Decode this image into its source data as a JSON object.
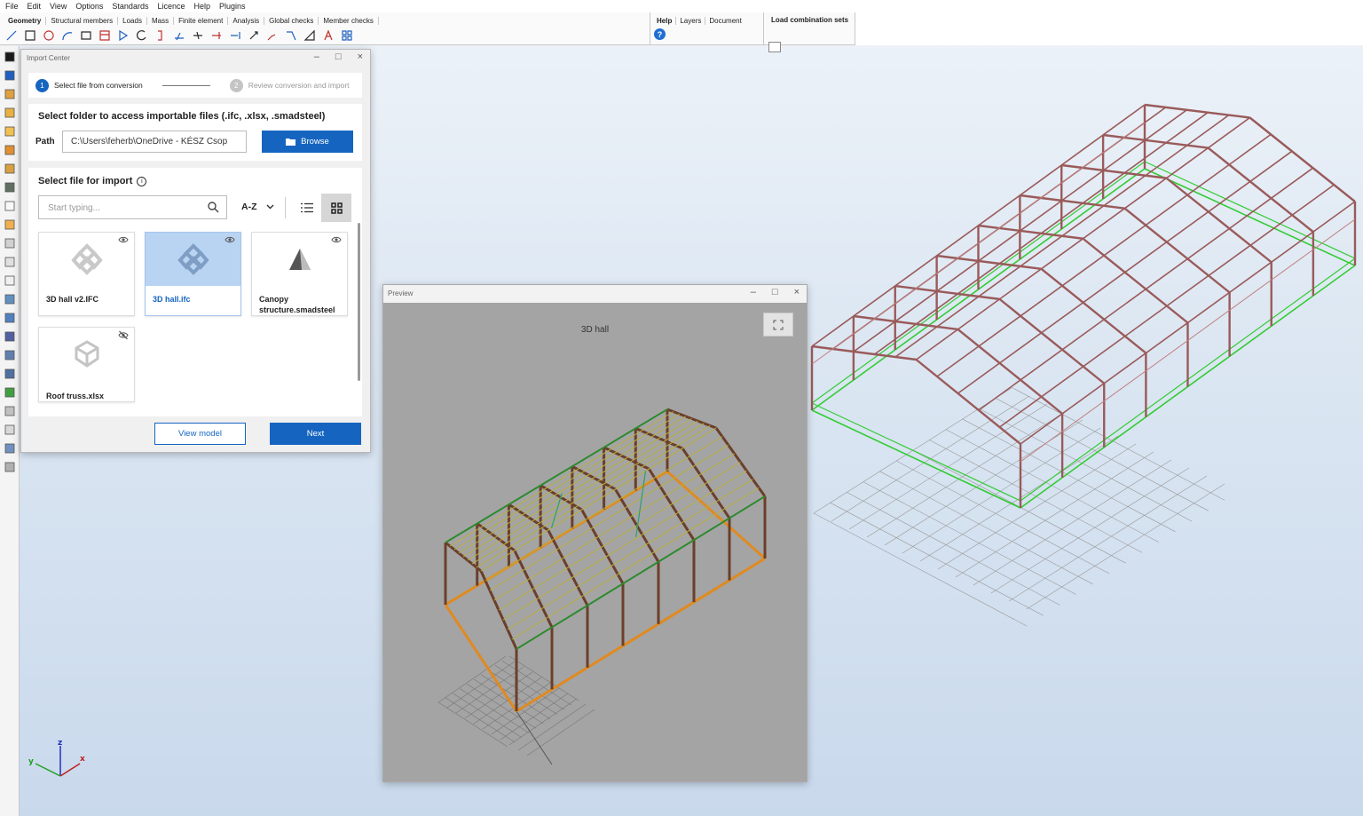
{
  "menu": [
    "File",
    "Edit",
    "View",
    "Options",
    "Standards",
    "Licence",
    "Help",
    "Plugins"
  ],
  "ribbon": {
    "tabs": [
      "Geometry",
      "Structural members",
      "Loads",
      "Mass",
      "Finite element",
      "Analysis",
      "Global checks",
      "Member checks"
    ],
    "help_tabs": [
      "Help",
      "Layers",
      "Document"
    ],
    "load_group_title": "Load combination sets",
    "help_icon_text": "?"
  },
  "import_center": {
    "title": "Import Center",
    "steps": [
      {
        "number": "1",
        "label": "Select file from conversion",
        "active": true
      },
      {
        "number": "2",
        "label": "Review conversion and import",
        "active": false
      }
    ],
    "folder_title": "Select folder to access importable files (.ifc, .xlsx, .smadsteel)",
    "path_label": "Path",
    "path_value": "C:\\Users\\feherb\\OneDrive - KÉSZ Csop",
    "browse_label": "Browse",
    "file_title": "Select file for import",
    "info_glyph": "i",
    "search_placeholder": "Start typing...",
    "sort_label": "A-Z",
    "files": [
      {
        "name": "3D hall v2.IFC",
        "icon": "ifc-icon",
        "visible": true,
        "selected": false
      },
      {
        "name": "3D hall.ifc",
        "icon": "ifc-icon",
        "visible": true,
        "selected": true
      },
      {
        "name": "Canopy structure.smadsteel",
        "icon": "smadsteel-icon",
        "visible": true,
        "selected": false
      },
      {
        "name": "Roof truss.xlsx",
        "icon": "xlsx-icon",
        "visible": false,
        "selected": false
      }
    ],
    "view_model_label": "View model",
    "next_label": "Next"
  },
  "preview": {
    "title": "Preview",
    "heading": "3D hall"
  },
  "axes": {
    "z": "z",
    "y": "y",
    "x": "x"
  },
  "colors": {
    "accent": "#1565c0",
    "frame_member": "#8a4a4a",
    "base_outline": "#35c235",
    "preview_background": "#a4a4a4"
  }
}
